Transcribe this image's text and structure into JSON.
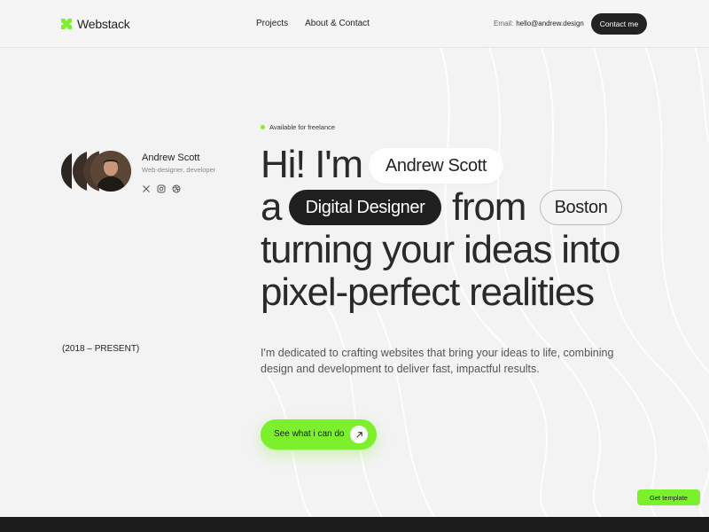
{
  "header": {
    "logo": "Webstack",
    "nav": [
      {
        "label": "Projects"
      },
      {
        "label": "About & Contact"
      }
    ],
    "email_label": "Email:",
    "email_value": "hello@andrew.design",
    "contact_label": "Contact me"
  },
  "profile": {
    "name": "Andrew Scott",
    "role": "Web-designer, developer",
    "socials": [
      "x-icon",
      "instagram-icon",
      "dribbble-icon"
    ]
  },
  "period": "(2018 – PRESENT)",
  "hero": {
    "availability": "Available for freelance",
    "line1_prefix": "Hi! I'm",
    "name_pill": "Andrew Scott",
    "line2_prefix": "a",
    "role_pill": "Digital Designer",
    "line2_mid": "from",
    "city_pill": "Boston",
    "line3": "turning your ideas into",
    "line4": "pixel-perfect realities",
    "description": "I'm dedicated to crafting websites that bring your ideas to life, combining design and development to deliver fast, impactful results.",
    "cta_label": "See what i can do"
  },
  "get_template_label": "Get template",
  "colors": {
    "accent": "#7df02e",
    "dark": "#1f1f1f",
    "background": "#f3f3f3"
  }
}
